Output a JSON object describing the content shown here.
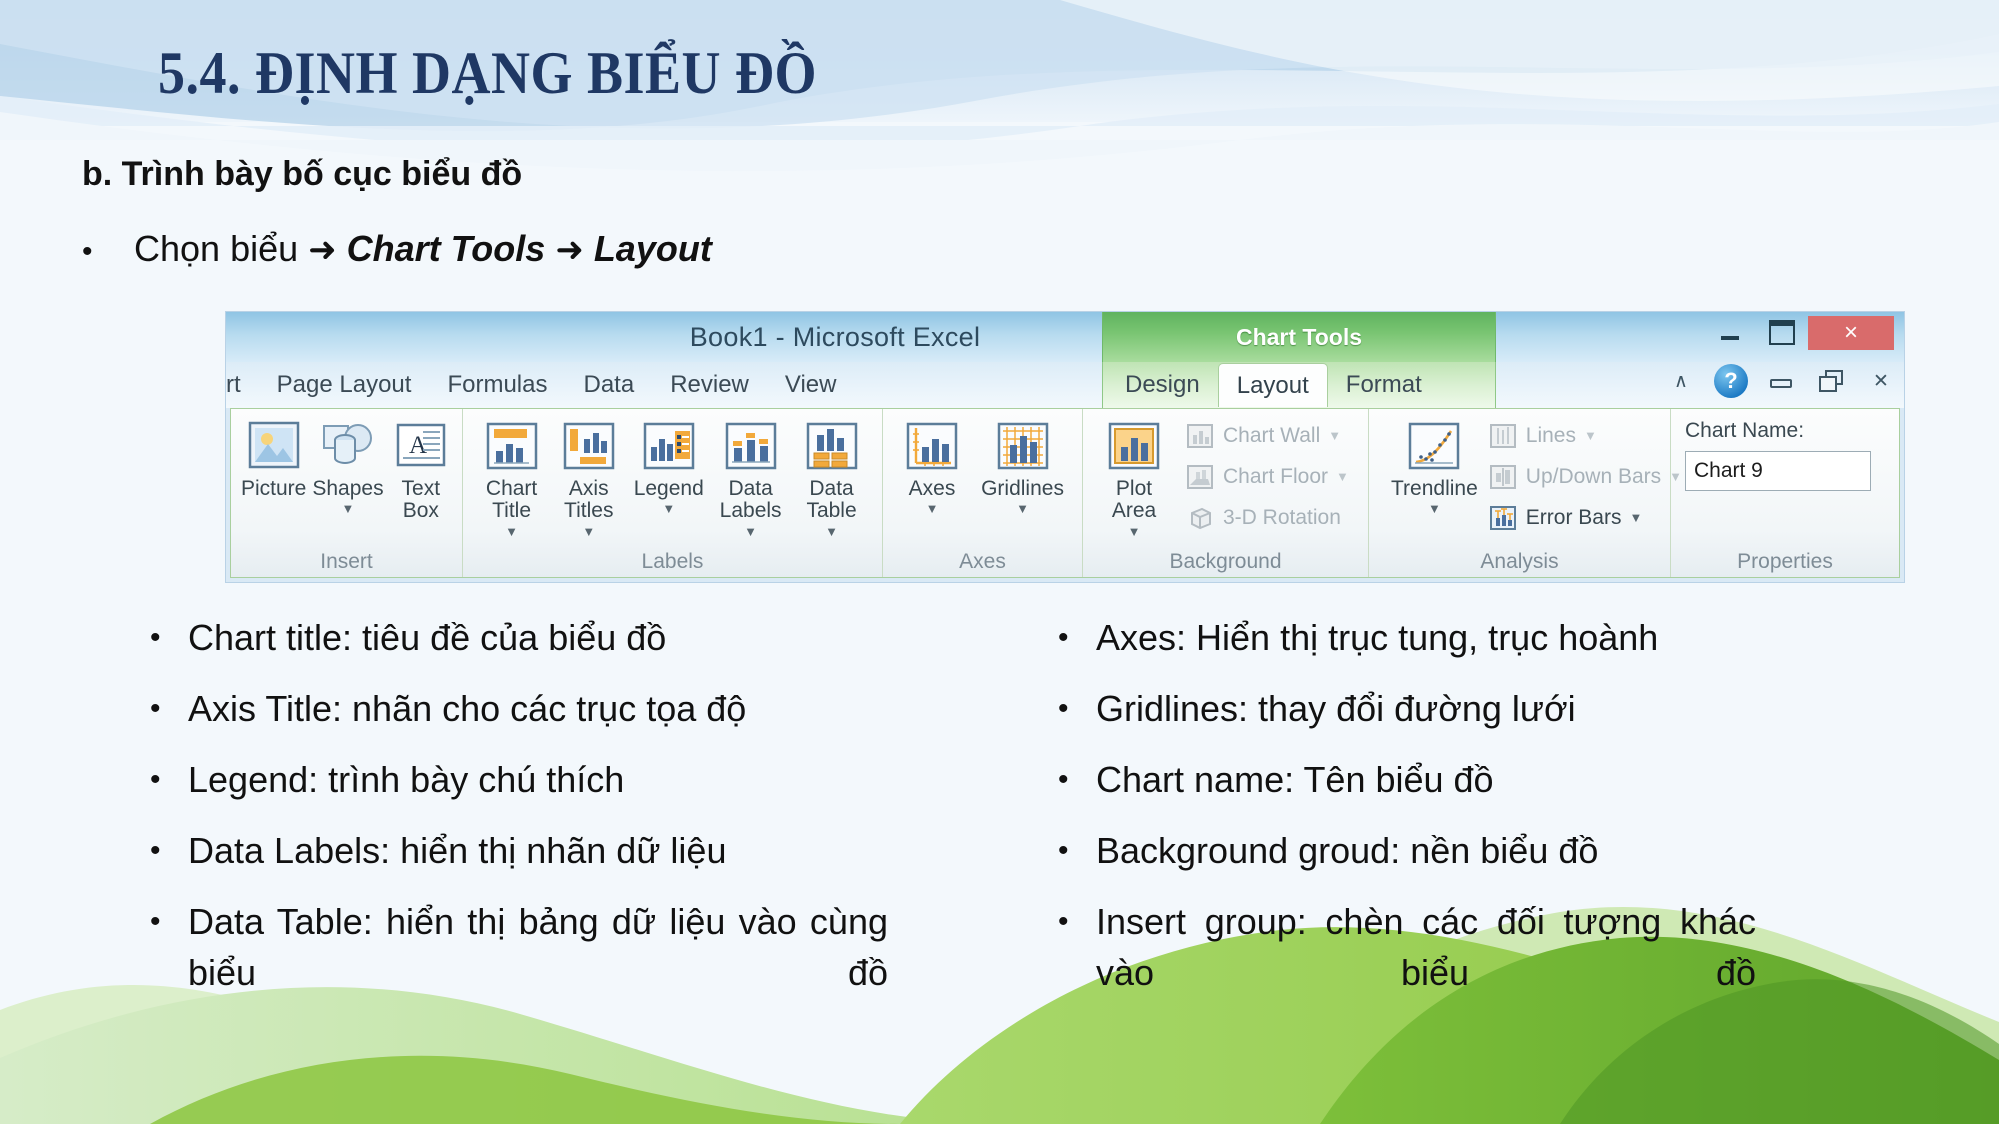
{
  "slide": {
    "title": "5.4. ĐỊNH DẠNG BIỂU ĐỒ",
    "subhead": "b. Trình bày bố cục biểu đồ",
    "intro": {
      "bullet": "•",
      "plain": "Chọn biểu",
      "arrow1": "➜",
      "em1": "Chart Tools",
      "arrow2": "➜",
      "em2": "Layout"
    },
    "colors": {
      "title": "#1f3864",
      "body": "#111111",
      "banner_blue": "#bdd7ee",
      "hill_green": "#92d050"
    }
  },
  "excel": {
    "window_title": "Book1  -  Microsoft Excel",
    "window_controls": {
      "minimize": "minimize",
      "maximize": "maximize",
      "close": "×"
    },
    "quick_bar": {
      "collapse_ribbon": "∧",
      "help": "?",
      "minimize": "minimize",
      "restore": "restore",
      "close": "✕"
    },
    "tabs": [
      "rt",
      "Page Layout",
      "Formulas",
      "Data",
      "Review",
      "View"
    ],
    "context_tab": {
      "title": "Chart Tools",
      "tabs": [
        "Design",
        "Layout",
        "Format"
      ],
      "active": "Layout"
    },
    "groups": [
      {
        "name": "Insert",
        "label": "Insert",
        "buttons": [
          {
            "label": "Picture",
            "icon": "picture-icon",
            "caret": false,
            "enabled": true
          },
          {
            "label": "Shapes",
            "icon": "shapes-icon",
            "caret": true,
            "enabled": true
          },
          {
            "label": "Text\nBox",
            "icon": "textbox-icon",
            "caret": false,
            "enabled": true
          }
        ]
      },
      {
        "name": "Labels",
        "label": "Labels",
        "buttons": [
          {
            "label": "Chart\nTitle",
            "icon": "chart-title-icon",
            "caret": true,
            "enabled": true
          },
          {
            "label": "Axis\nTitles",
            "icon": "axis-titles-icon",
            "caret": true,
            "enabled": true
          },
          {
            "label": "Legend",
            "icon": "legend-icon",
            "caret": true,
            "enabled": true
          },
          {
            "label": "Data\nLabels",
            "icon": "data-labels-icon",
            "caret": true,
            "enabled": true
          },
          {
            "label": "Data\nTable",
            "icon": "data-table-icon",
            "caret": true,
            "enabled": true
          }
        ]
      },
      {
        "name": "Axes",
        "label": "Axes",
        "buttons": [
          {
            "label": "Axes",
            "icon": "axes-icon",
            "caret": true,
            "enabled": true
          },
          {
            "label": "Gridlines",
            "icon": "gridlines-icon",
            "caret": true,
            "enabled": true
          }
        ]
      },
      {
        "name": "Background",
        "label": "Background",
        "buttons": [
          {
            "label": "Plot\nArea",
            "icon": "plot-area-icon",
            "caret": true,
            "enabled": true
          }
        ],
        "small_buttons": [
          {
            "label": "Chart Wall",
            "icon": "chart-wall-icon",
            "caret": true,
            "enabled": false
          },
          {
            "label": "Chart Floor",
            "icon": "chart-floor-icon",
            "caret": true,
            "enabled": false
          },
          {
            "label": "3-D Rotation",
            "icon": "rotation-3d-icon",
            "caret": false,
            "enabled": false
          }
        ]
      },
      {
        "name": "Analysis",
        "label": "Analysis",
        "buttons": [
          {
            "label": "Trendline",
            "icon": "trendline-icon",
            "caret": true,
            "enabled": true
          }
        ],
        "small_buttons": [
          {
            "label": "Lines",
            "icon": "lines-icon",
            "caret": true,
            "enabled": false
          },
          {
            "label": "Up/Down Bars",
            "icon": "updown-bars-icon",
            "caret": true,
            "enabled": false
          },
          {
            "label": "Error Bars",
            "icon": "error-bars-icon",
            "caret": true,
            "enabled": true
          }
        ]
      },
      {
        "name": "Properties",
        "label": "Properties",
        "field_label": "Chart Name:",
        "field_value": "Chart 9"
      }
    ]
  },
  "content": {
    "left_column": [
      {
        "bullet": "•",
        "text": "Chart title:  tiêu đề của biểu đồ",
        "justify": false
      },
      {
        "bullet": "•",
        "text": "Axis Title: nhãn cho các trục tọa độ",
        "justify": false
      },
      {
        "bullet": "•",
        "text": "Legend: trình bày chú thích",
        "justify": false
      },
      {
        "bullet": "•",
        "text": "Data Labels: hiển thị nhãn dữ liệu",
        "justify": false
      },
      {
        "bullet": "•",
        "text": "Data Table: hiển thị bảng dữ liệu vào cùng biểu đồ",
        "justify": true
      }
    ],
    "right_column": [
      {
        "bullet": "•",
        "text": "Axes: Hiển thị trục tung, trục hoành",
        "justify": false
      },
      {
        "bullet": "•",
        "text": "Gridlines: thay đổi đường lưới",
        "justify": false
      },
      {
        "bullet": "•",
        "text": "Chart name: Tên biểu đồ",
        "justify": false
      },
      {
        "bullet": "•",
        "text": "Background groud: nền biểu đồ",
        "justify": false
      },
      {
        "bullet": "•",
        "text": "Insert group: chèn các đối tượng khác vào biểu đồ",
        "justify": true
      }
    ]
  }
}
